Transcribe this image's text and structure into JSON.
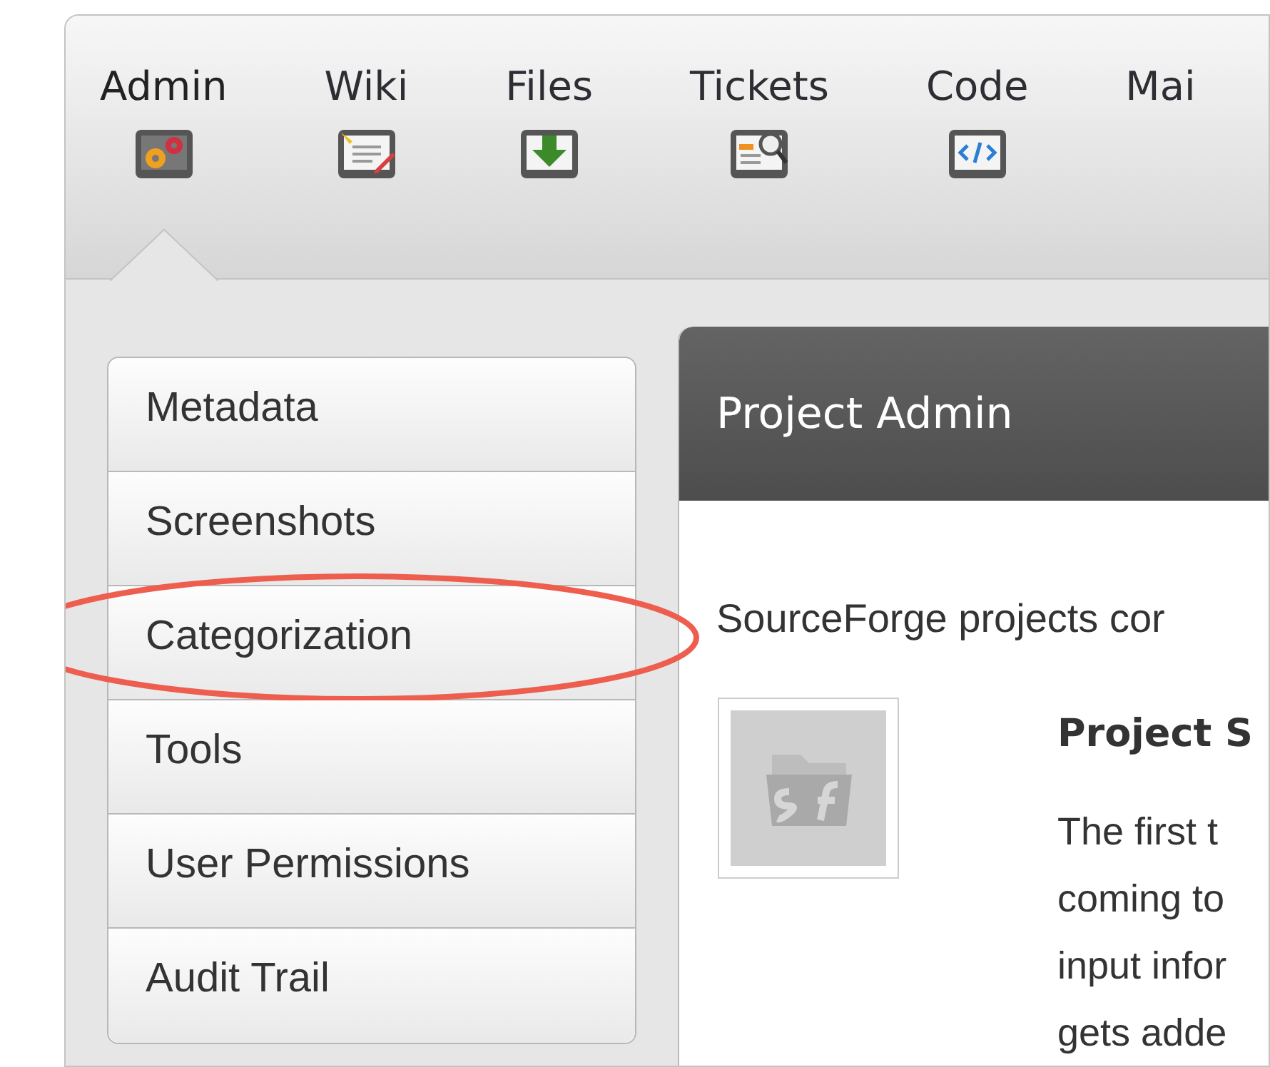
{
  "tabs": [
    {
      "label": "Admin",
      "selected": true
    },
    {
      "label": "Wiki",
      "selected": false
    },
    {
      "label": "Files",
      "selected": false
    },
    {
      "label": "Tickets",
      "selected": false
    },
    {
      "label": "Code",
      "selected": false
    },
    {
      "label": "Mai",
      "selected": false
    }
  ],
  "sidebar": {
    "items": [
      {
        "label": "Metadata",
        "circled": false
      },
      {
        "label": "Screenshots",
        "circled": false
      },
      {
        "label": "Categorization",
        "circled": true
      },
      {
        "label": "Tools",
        "circled": false
      },
      {
        "label": "User Permissions",
        "circled": false
      },
      {
        "label": "Audit Trail",
        "circled": false
      }
    ]
  },
  "panel": {
    "title": "Project Admin",
    "intro": "SourceForge projects cor",
    "section": {
      "title": "Project S",
      "lines": [
        "The first t",
        "coming to",
        "input infor",
        "gets adde"
      ]
    }
  }
}
